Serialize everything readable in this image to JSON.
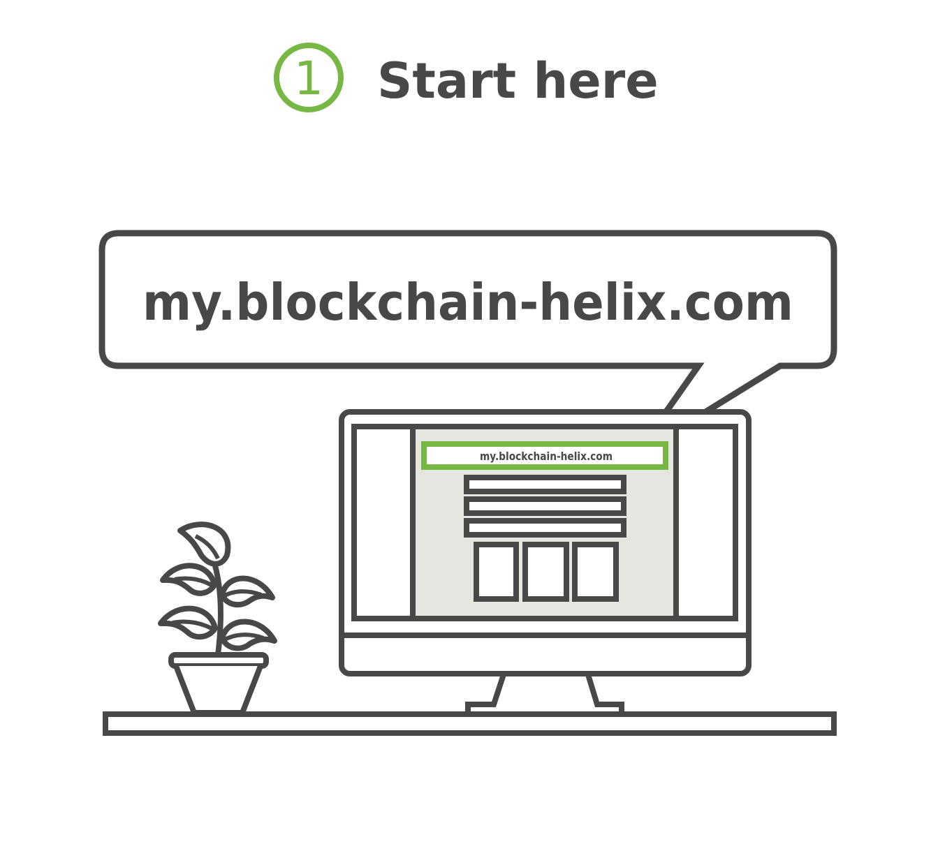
{
  "step": {
    "number": "1",
    "title": "Start here"
  },
  "speech_bubble": {
    "url_text": "my.blockchain-helix.com"
  },
  "monitor": {
    "address_bar_text": "my.blockchain-helix.com"
  },
  "colors": {
    "accent_green": "#76b843",
    "outline_dark": "#474847",
    "screen_fill": "#e6e6e1",
    "background": "#ffffff"
  },
  "icons": {
    "step_badge": "circled-number-icon",
    "plant": "potted-plant-icon",
    "computer": "desktop-monitor-icon"
  }
}
